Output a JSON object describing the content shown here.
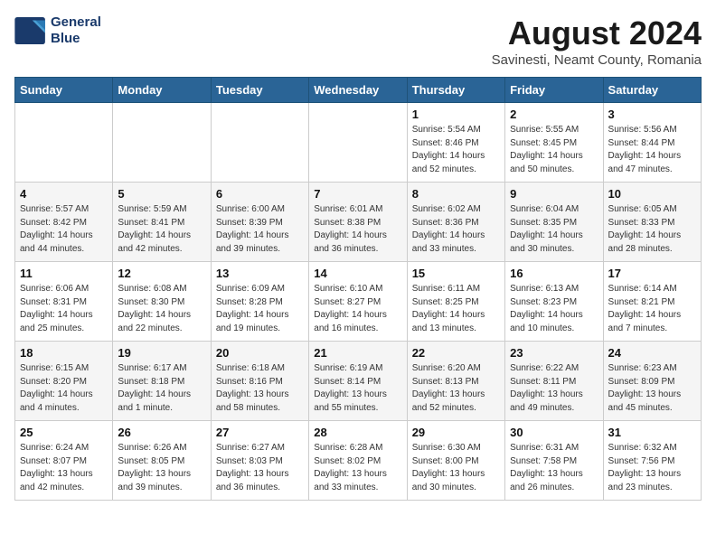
{
  "header": {
    "logo_line1": "General",
    "logo_line2": "Blue",
    "month_year": "August 2024",
    "location": "Savinesti, Neamt County, Romania"
  },
  "weekdays": [
    "Sunday",
    "Monday",
    "Tuesday",
    "Wednesday",
    "Thursday",
    "Friday",
    "Saturday"
  ],
  "weeks": [
    [
      {
        "day": "",
        "detail": ""
      },
      {
        "day": "",
        "detail": ""
      },
      {
        "day": "",
        "detail": ""
      },
      {
        "day": "",
        "detail": ""
      },
      {
        "day": "1",
        "detail": "Sunrise: 5:54 AM\nSunset: 8:46 PM\nDaylight: 14 hours\nand 52 minutes."
      },
      {
        "day": "2",
        "detail": "Sunrise: 5:55 AM\nSunset: 8:45 PM\nDaylight: 14 hours\nand 50 minutes."
      },
      {
        "day": "3",
        "detail": "Sunrise: 5:56 AM\nSunset: 8:44 PM\nDaylight: 14 hours\nand 47 minutes."
      }
    ],
    [
      {
        "day": "4",
        "detail": "Sunrise: 5:57 AM\nSunset: 8:42 PM\nDaylight: 14 hours\nand 44 minutes."
      },
      {
        "day": "5",
        "detail": "Sunrise: 5:59 AM\nSunset: 8:41 PM\nDaylight: 14 hours\nand 42 minutes."
      },
      {
        "day": "6",
        "detail": "Sunrise: 6:00 AM\nSunset: 8:39 PM\nDaylight: 14 hours\nand 39 minutes."
      },
      {
        "day": "7",
        "detail": "Sunrise: 6:01 AM\nSunset: 8:38 PM\nDaylight: 14 hours\nand 36 minutes."
      },
      {
        "day": "8",
        "detail": "Sunrise: 6:02 AM\nSunset: 8:36 PM\nDaylight: 14 hours\nand 33 minutes."
      },
      {
        "day": "9",
        "detail": "Sunrise: 6:04 AM\nSunset: 8:35 PM\nDaylight: 14 hours\nand 30 minutes."
      },
      {
        "day": "10",
        "detail": "Sunrise: 6:05 AM\nSunset: 8:33 PM\nDaylight: 14 hours\nand 28 minutes."
      }
    ],
    [
      {
        "day": "11",
        "detail": "Sunrise: 6:06 AM\nSunset: 8:31 PM\nDaylight: 14 hours\nand 25 minutes."
      },
      {
        "day": "12",
        "detail": "Sunrise: 6:08 AM\nSunset: 8:30 PM\nDaylight: 14 hours\nand 22 minutes."
      },
      {
        "day": "13",
        "detail": "Sunrise: 6:09 AM\nSunset: 8:28 PM\nDaylight: 14 hours\nand 19 minutes."
      },
      {
        "day": "14",
        "detail": "Sunrise: 6:10 AM\nSunset: 8:27 PM\nDaylight: 14 hours\nand 16 minutes."
      },
      {
        "day": "15",
        "detail": "Sunrise: 6:11 AM\nSunset: 8:25 PM\nDaylight: 14 hours\nand 13 minutes."
      },
      {
        "day": "16",
        "detail": "Sunrise: 6:13 AM\nSunset: 8:23 PM\nDaylight: 14 hours\nand 10 minutes."
      },
      {
        "day": "17",
        "detail": "Sunrise: 6:14 AM\nSunset: 8:21 PM\nDaylight: 14 hours\nand 7 minutes."
      }
    ],
    [
      {
        "day": "18",
        "detail": "Sunrise: 6:15 AM\nSunset: 8:20 PM\nDaylight: 14 hours\nand 4 minutes."
      },
      {
        "day": "19",
        "detail": "Sunrise: 6:17 AM\nSunset: 8:18 PM\nDaylight: 14 hours\nand 1 minute."
      },
      {
        "day": "20",
        "detail": "Sunrise: 6:18 AM\nSunset: 8:16 PM\nDaylight: 13 hours\nand 58 minutes."
      },
      {
        "day": "21",
        "detail": "Sunrise: 6:19 AM\nSunset: 8:14 PM\nDaylight: 13 hours\nand 55 minutes."
      },
      {
        "day": "22",
        "detail": "Sunrise: 6:20 AM\nSunset: 8:13 PM\nDaylight: 13 hours\nand 52 minutes."
      },
      {
        "day": "23",
        "detail": "Sunrise: 6:22 AM\nSunset: 8:11 PM\nDaylight: 13 hours\nand 49 minutes."
      },
      {
        "day": "24",
        "detail": "Sunrise: 6:23 AM\nSunset: 8:09 PM\nDaylight: 13 hours\nand 45 minutes."
      }
    ],
    [
      {
        "day": "25",
        "detail": "Sunrise: 6:24 AM\nSunset: 8:07 PM\nDaylight: 13 hours\nand 42 minutes."
      },
      {
        "day": "26",
        "detail": "Sunrise: 6:26 AM\nSunset: 8:05 PM\nDaylight: 13 hours\nand 39 minutes."
      },
      {
        "day": "27",
        "detail": "Sunrise: 6:27 AM\nSunset: 8:03 PM\nDaylight: 13 hours\nand 36 minutes."
      },
      {
        "day": "28",
        "detail": "Sunrise: 6:28 AM\nSunset: 8:02 PM\nDaylight: 13 hours\nand 33 minutes."
      },
      {
        "day": "29",
        "detail": "Sunrise: 6:30 AM\nSunset: 8:00 PM\nDaylight: 13 hours\nand 30 minutes."
      },
      {
        "day": "30",
        "detail": "Sunrise: 6:31 AM\nSunset: 7:58 PM\nDaylight: 13 hours\nand 26 minutes."
      },
      {
        "day": "31",
        "detail": "Sunrise: 6:32 AM\nSunset: 7:56 PM\nDaylight: 13 hours\nand 23 minutes."
      }
    ]
  ]
}
